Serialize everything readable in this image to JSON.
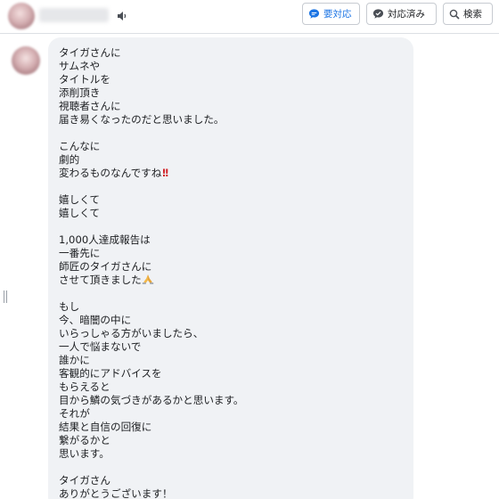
{
  "header": {
    "contact_name": "",
    "buttons": {
      "needs_action": "要対応",
      "done": "対応済み",
      "search": "検索"
    }
  },
  "message": {
    "lines": [
      "タイガさんに",
      "サムネや",
      "タイトルを",
      "添削頂き",
      "視聴者さんに",
      "届き易くなったのだと思いました。",
      "",
      "こんなに",
      "劇的",
      "変わるものなんですね",
      "",
      "嬉しくて",
      "嬉しくて",
      "",
      "1,000人達成報告は",
      "一番先に",
      "師匠のタイガさんに",
      "させて頂きました",
      "",
      "もし",
      "今、暗闇の中に",
      "いらっしゃる方がいましたら、",
      "一人で悩まないで",
      "誰かに",
      "客観的にアドバイスを",
      "もらえると",
      "目から鱗の気づきがあるかと思います。",
      "それが",
      "結果と自信の回復に",
      "繋がるかと",
      "思います。",
      "",
      "タイガさん",
      "ありがとうございます！"
    ]
  },
  "icons": {
    "speaker": "speaker-icon",
    "needs_action": "speech-bubble-icon",
    "done": "chat-check-icon",
    "search": "search-icon",
    "emoji_exclamation": "double-exclamation-emoji",
    "emoji_thanks": "folded-hands-emoji"
  },
  "colors": {
    "accent": "#1b74e4",
    "bubble": "#f0f2f5",
    "text": "#1c1e21",
    "exclamation": "#d2262b"
  }
}
